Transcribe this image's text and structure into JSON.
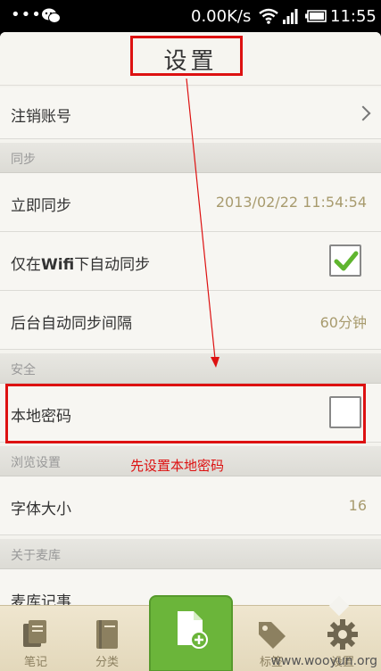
{
  "status_bar": {
    "dots": "•••",
    "net_speed": "0.00K/s",
    "time": "11:55"
  },
  "header": {
    "title": "设置"
  },
  "rows": {
    "logout": {
      "label": "注销账号"
    },
    "sync_section": {
      "label": "同步"
    },
    "sync_now": {
      "label": "立即同步",
      "value": "2013/02/22 11:54:54"
    },
    "wifi_only": {
      "label_pre": "仅在",
      "label_bold": "Wifi",
      "label_post": "下自动同步",
      "checked": true
    },
    "sync_interval": {
      "label": "后台自动同步间隔",
      "value": "60分钟"
    },
    "security_section": {
      "label": "安全"
    },
    "local_password": {
      "label": "本地密码",
      "checked": false
    },
    "browse_section": {
      "label": "浏览设置"
    },
    "font_size": {
      "label": "字体大小",
      "value": "16"
    },
    "about_section": {
      "label": "关于麦库"
    },
    "about_partial": {
      "label": "麦库记事"
    }
  },
  "annotation": {
    "text": "先设置本地密码",
    "color": "#dd1111"
  },
  "bottom_nav": {
    "items": [
      {
        "label": "笔记",
        "icon": "notes-icon"
      },
      {
        "label": "分类",
        "icon": "category-book-icon"
      },
      {
        "label": "",
        "icon": "new-note-icon"
      },
      {
        "label": "标签",
        "icon": "tag-icon"
      },
      {
        "label": "设置",
        "icon": "gear-icon"
      }
    ]
  },
  "watermark": "www.wooyun.org",
  "colors": {
    "accent_green": "#6bb53a",
    "value_text": "#a89b6e",
    "annotation_red": "#dd1111"
  }
}
